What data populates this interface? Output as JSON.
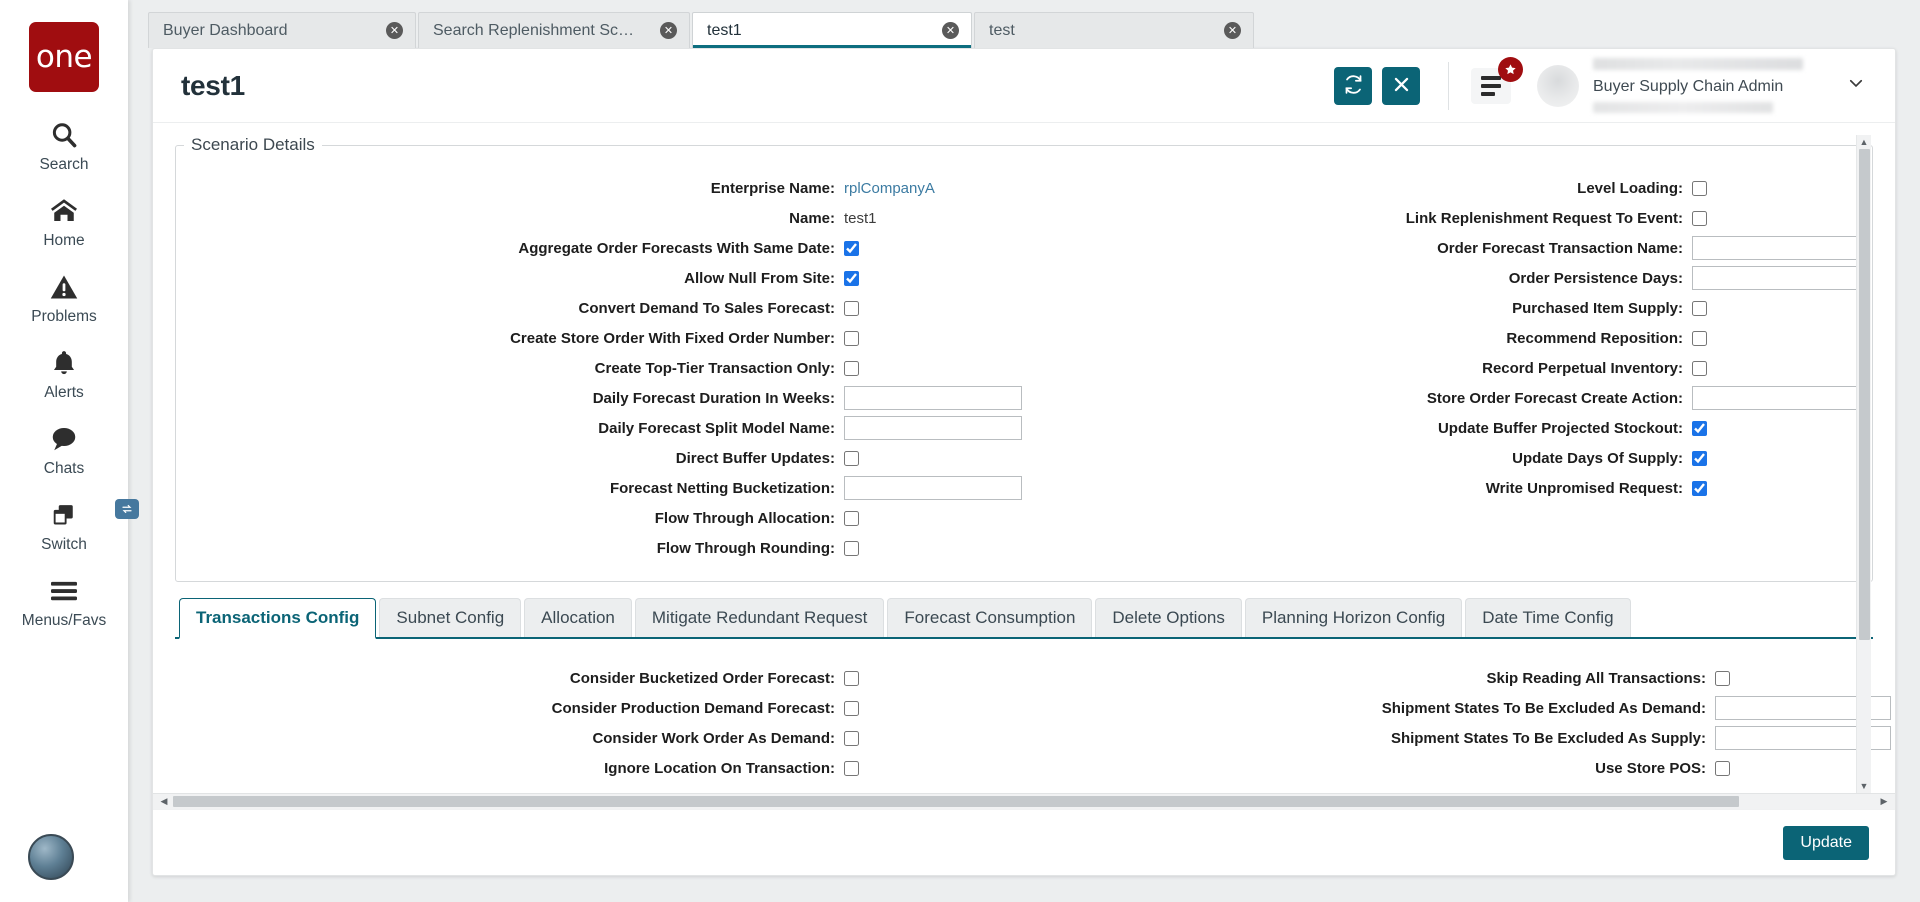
{
  "brand": {
    "logo_text": "one",
    "logo_color": "#a00d10",
    "accent": "#0b6476"
  },
  "sidebar": {
    "items": [
      {
        "label": "Search",
        "icon": "search-icon"
      },
      {
        "label": "Home",
        "icon": "home-icon"
      },
      {
        "label": "Problems",
        "icon": "warning-triangle-icon"
      },
      {
        "label": "Alerts",
        "icon": "bell-icon"
      },
      {
        "label": "Chats",
        "icon": "chat-bubble-icon"
      },
      {
        "label": "Switch",
        "icon": "switch-windows-icon",
        "badge_icon": "swap-arrows-icon"
      },
      {
        "label": "Menus/Favs",
        "icon": "hamburger-icon"
      }
    ],
    "globe": "globe-icon"
  },
  "browser_tabs": [
    {
      "label": "Buyer Dashboard",
      "active": false,
      "close": "✕"
    },
    {
      "label": "Search Replenishment Scenario",
      "active": false,
      "close": "✕"
    },
    {
      "label": "test1",
      "active": true,
      "close": "✕"
    },
    {
      "label": "test",
      "active": false,
      "close": "✕"
    }
  ],
  "header": {
    "title": "test1",
    "refresh_icon": "refresh-icon",
    "close_icon": "close-icon",
    "menu_icon": "hamburger-icon",
    "star_badge_icon": "star-icon",
    "user_role": "Buyer Supply Chain Admin",
    "caret_icon": "chevron-down-icon"
  },
  "scenario_details": {
    "legend": "Scenario Details",
    "left": [
      {
        "label": "Enterprise Name:",
        "type": "link",
        "value": "rplCompanyA"
      },
      {
        "label": "Name:",
        "type": "text",
        "value": "test1"
      },
      {
        "label": "Aggregate Order Forecasts With Same Date:",
        "type": "checkbox",
        "checked": true
      },
      {
        "label": "Allow Null From Site:",
        "type": "checkbox",
        "checked": true
      },
      {
        "label": "Convert Demand To Sales Forecast:",
        "type": "checkbox",
        "checked": false
      },
      {
        "label": "Create Store Order With Fixed Order Number:",
        "type": "checkbox",
        "checked": false
      },
      {
        "label": "Create Top-Tier Transaction Only:",
        "type": "checkbox",
        "checked": false
      },
      {
        "label": "Daily Forecast Duration In Weeks:",
        "type": "input",
        "value": ""
      },
      {
        "label": "Daily Forecast Split Model Name:",
        "type": "input",
        "value": ""
      },
      {
        "label": "Direct Buffer Updates:",
        "type": "checkbox",
        "checked": false
      },
      {
        "label": "Forecast Netting Bucketization:",
        "type": "input",
        "value": ""
      },
      {
        "label": "Flow Through Allocation:",
        "type": "checkbox",
        "checked": false
      },
      {
        "label": "Flow Through Rounding:",
        "type": "checkbox",
        "checked": false
      }
    ],
    "right": [
      {
        "label": "Level Loading:",
        "type": "checkbox",
        "checked": false
      },
      {
        "label": "Link Replenishment Request To Event:",
        "type": "checkbox",
        "checked": false
      },
      {
        "label": "Order Forecast Transaction Name:",
        "type": "input",
        "value": ""
      },
      {
        "label": "Order Persistence Days:",
        "type": "input",
        "value": ""
      },
      {
        "label": "Purchased Item Supply:",
        "type": "checkbox",
        "checked": false
      },
      {
        "label": "Recommend Reposition:",
        "type": "checkbox",
        "checked": false
      },
      {
        "label": "Record Perpetual Inventory:",
        "type": "checkbox",
        "checked": false
      },
      {
        "label": "Store Order Forecast Create Action:",
        "type": "input",
        "value": ""
      },
      {
        "label": "Update Buffer Projected Stockout:",
        "type": "checkbox",
        "checked": true
      },
      {
        "label": "Update Days Of Supply:",
        "type": "checkbox",
        "checked": true
      },
      {
        "label": "Write Unpromised Request:",
        "type": "checkbox",
        "checked": true
      }
    ]
  },
  "config_tabs": [
    {
      "label": "Transactions Config",
      "active": true
    },
    {
      "label": "Subnet Config",
      "active": false
    },
    {
      "label": "Allocation",
      "active": false
    },
    {
      "label": "Mitigate Redundant Request",
      "active": false
    },
    {
      "label": "Forecast Consumption",
      "active": false
    },
    {
      "label": "Delete Options",
      "active": false
    },
    {
      "label": "Planning Horizon Config",
      "active": false
    },
    {
      "label": "Date Time Config",
      "active": false
    }
  ],
  "transactions_config": {
    "left": [
      {
        "label": "Consider Bucketized Order Forecast:",
        "type": "checkbox",
        "checked": false
      },
      {
        "label": "Consider Production Demand Forecast:",
        "type": "checkbox",
        "checked": false
      },
      {
        "label": "Consider Work Order As Demand:",
        "type": "checkbox",
        "checked": false
      },
      {
        "label": "Ignore Location On Transaction:",
        "type": "checkbox",
        "checked": false
      }
    ],
    "right": [
      {
        "label": "Skip Reading All Transactions:",
        "type": "checkbox",
        "checked": false
      },
      {
        "label": "Shipment States To Be Excluded As Demand:",
        "type": "input",
        "value": ""
      },
      {
        "label": "Shipment States To Be Excluded As Supply:",
        "type": "input",
        "value": ""
      },
      {
        "label": "Use Store POS:",
        "type": "checkbox",
        "checked": false
      }
    ]
  },
  "footer": {
    "update_label": "Update"
  },
  "scrollbars": {
    "v_up": "▲",
    "v_down": "▼",
    "h_left": "◀",
    "h_right": "▶"
  }
}
